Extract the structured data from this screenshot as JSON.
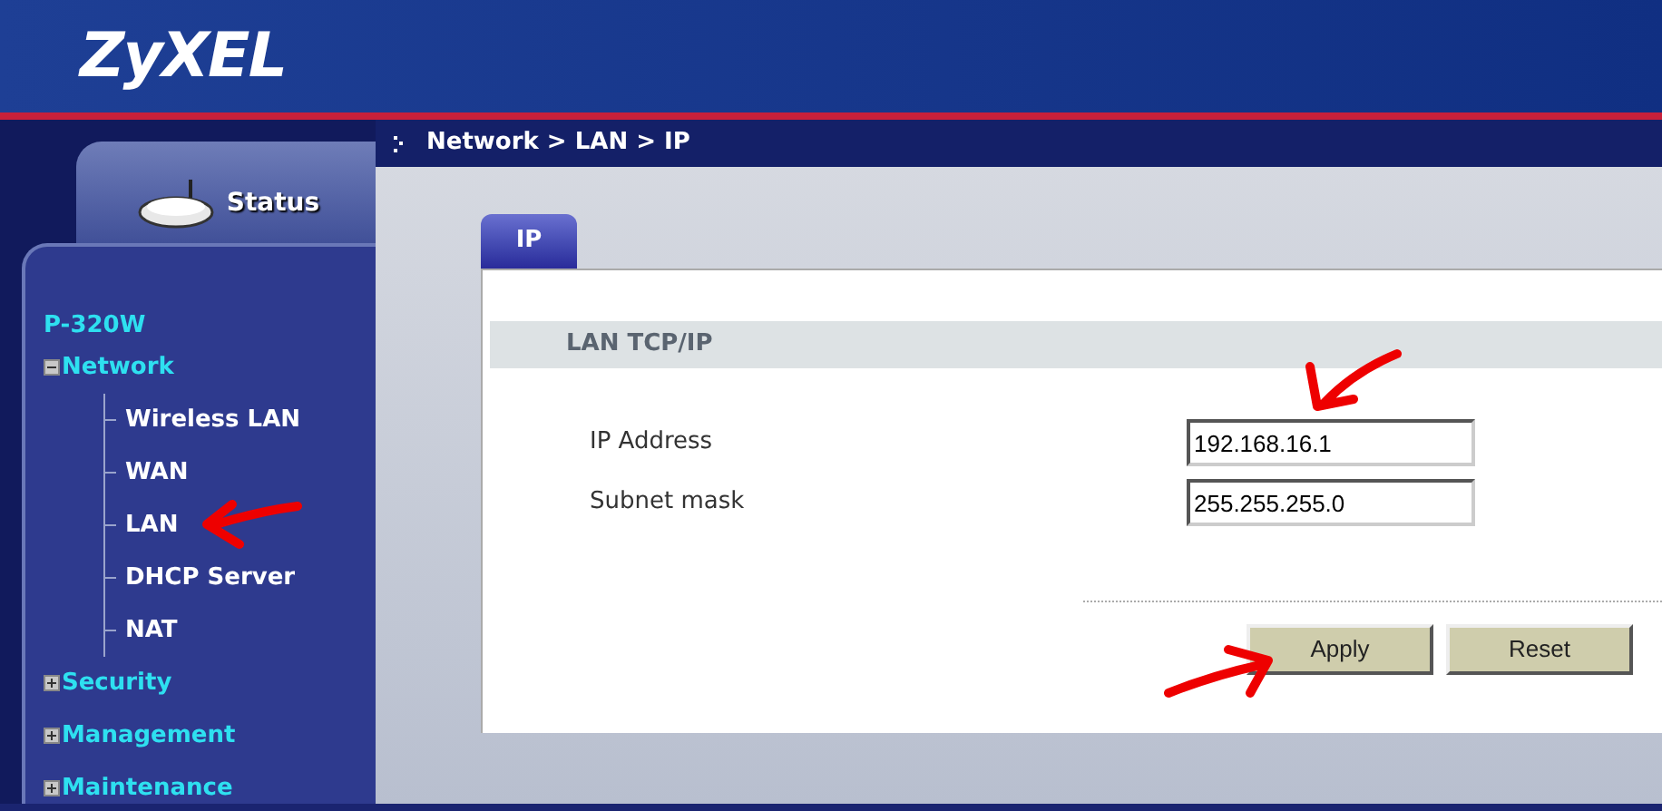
{
  "header": {
    "logo": "ZyXEL"
  },
  "sidebar": {
    "status_tab": "Status",
    "device": "P-320W",
    "tree": [
      {
        "label": "Network",
        "expanded": true,
        "children": [
          {
            "label": "Wireless LAN"
          },
          {
            "label": "WAN"
          },
          {
            "label": "LAN"
          },
          {
            "label": "DHCP Server"
          },
          {
            "label": "NAT"
          }
        ]
      },
      {
        "label": "Security",
        "expanded": false
      },
      {
        "label": "Management",
        "expanded": false
      },
      {
        "label": "Maintenance",
        "expanded": false
      }
    ]
  },
  "breadcrumb": "Network > LAN > IP",
  "tabs": [
    {
      "label": "IP",
      "selected": true
    }
  ],
  "section": {
    "title": "LAN TCP/IP",
    "fields": [
      {
        "label": "IP Address",
        "value": "192.168.16.1"
      },
      {
        "label": "Subnet mask",
        "value": "255.255.255.0"
      }
    ]
  },
  "buttons": [
    "Apply",
    "Reset"
  ]
}
